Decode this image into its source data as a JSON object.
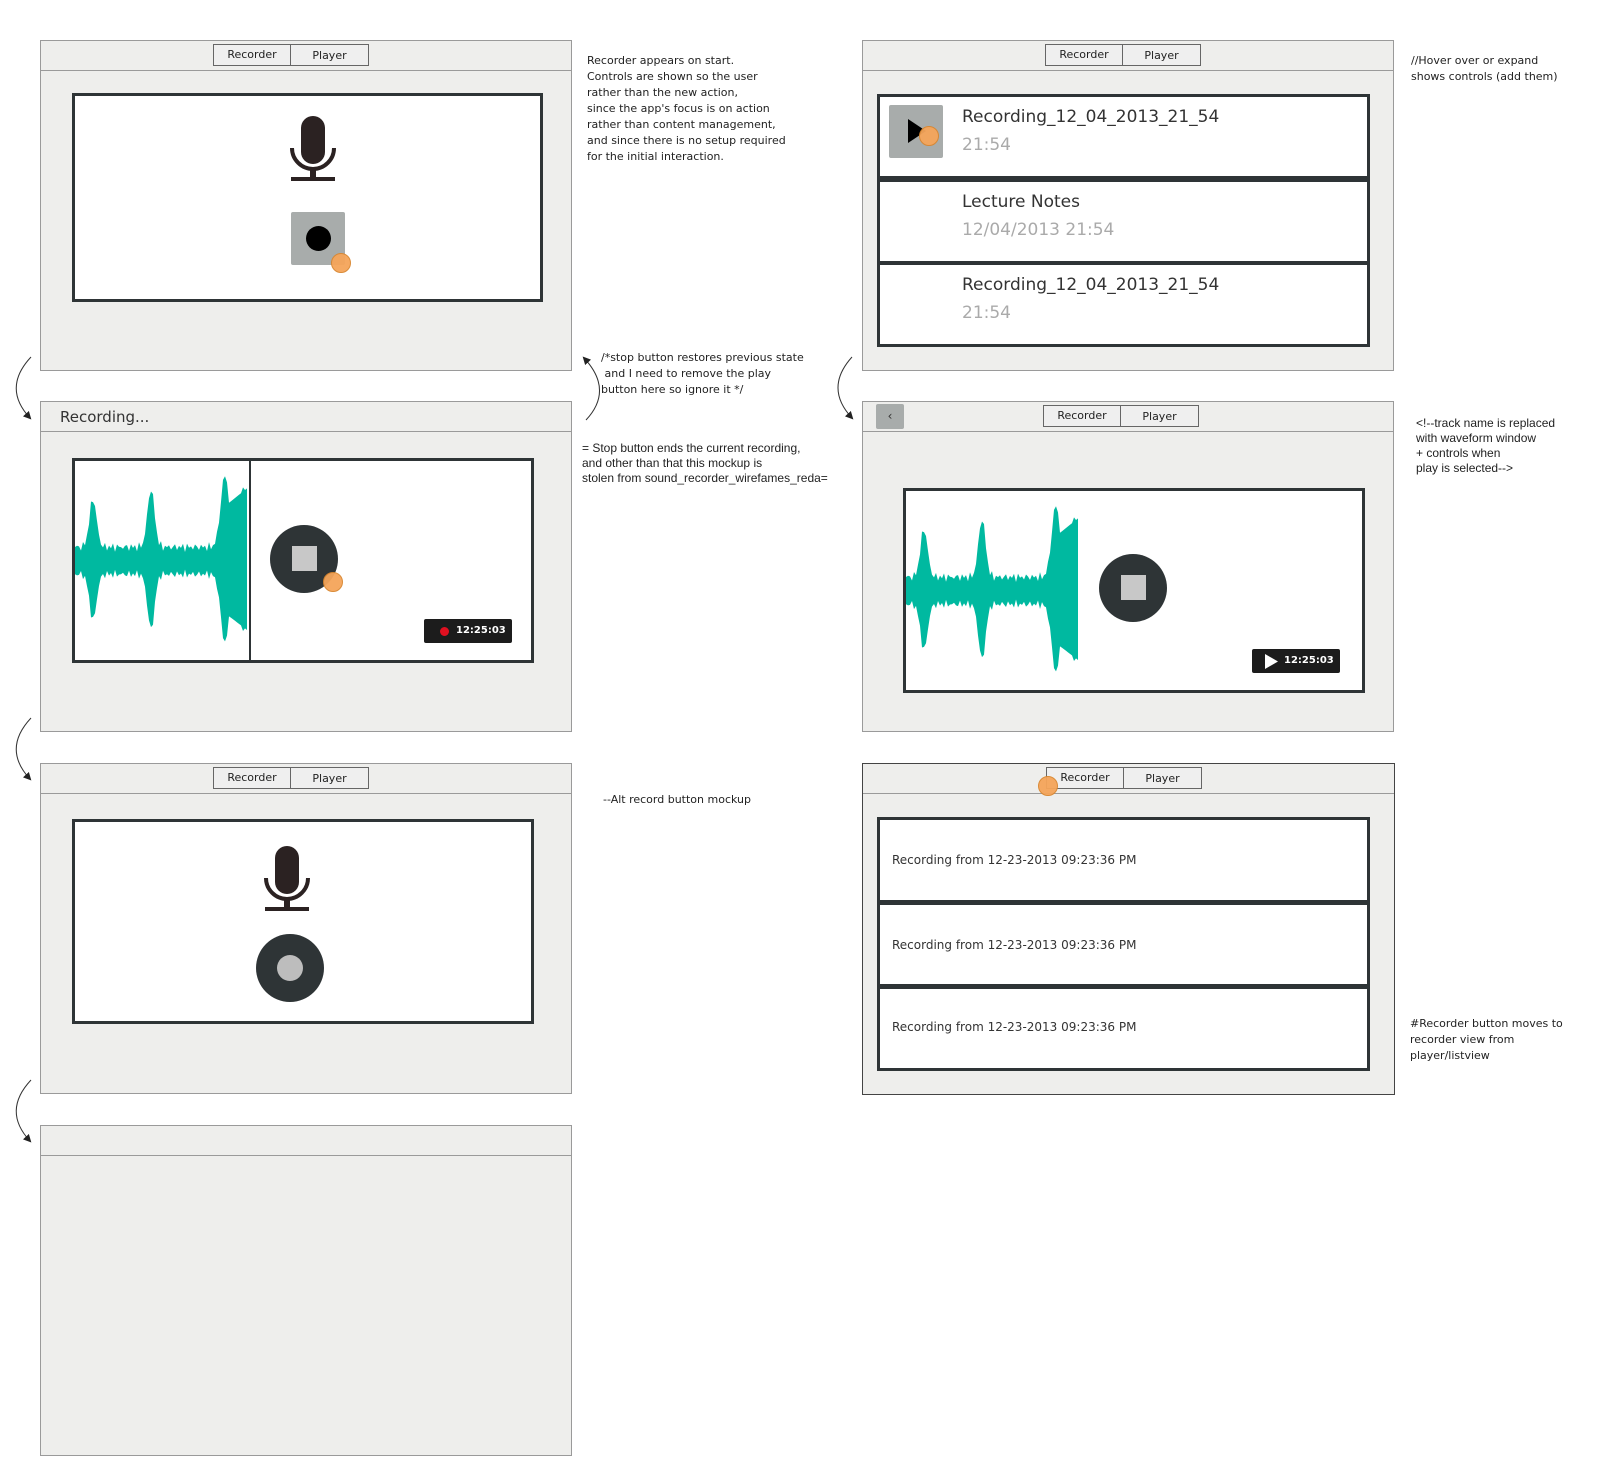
{
  "tabs": {
    "recorder": "Recorder",
    "player": "Player"
  },
  "frame_recorder": {},
  "frame_recording": {
    "title": "Recording...",
    "timer": "12:25:03"
  },
  "frame_alt": {},
  "frame_list": {
    "items": [
      {
        "title": "Recording_12_04_2013_21_54",
        "subtitle": "21:54"
      },
      {
        "title": "Lecture Notes",
        "subtitle": "12/04/2013  21:54"
      },
      {
        "title": "Recording_12_04_2013_21_54",
        "subtitle": "21:54"
      }
    ]
  },
  "frame_playing": {
    "back_label": "‹",
    "timer": "12:25:03"
  },
  "frame_list2": {
    "items": [
      "Recording from 12-23-2013 09:23:36 PM",
      "Recording from 12-23-2013 09:23:36 PM",
      "Recording from 12-23-2013 09:23:36 PM"
    ]
  },
  "notes": {
    "recorder_start": "Recorder appears on start.\nControls are shown so the user\nrather than the new action,\nsince the app's focus is on action\nrather than content management,\nand since there is no setup required\nfor the initial interaction.",
    "stop_restore": "/*stop button restores previous state\n and I need to remove the play\nbutton here so ignore it */",
    "stop_ends": "= Stop button ends the current recording,\nand other than that this mockup is\nstolen from sound_recorder_wirefames_reda=",
    "alt_record": "--Alt record button mockup",
    "hover": "//Hover over or expand\nshows controls (add them)",
    "track_name": "<!--track name is replaced\nwith waveform window\n+ controls when\nplay is selected-->",
    "recorder_moves": "#Recorder button moves to\nrecorder view from\nplayer/listview"
  },
  "colors": {
    "waveform": "#00b9a0",
    "dark_button": "#2e3436",
    "panel_border": "#2e3436",
    "frame_bg": "#eeeeec",
    "hover_marker": "#f5a55a",
    "record_dot": "#e01020"
  }
}
